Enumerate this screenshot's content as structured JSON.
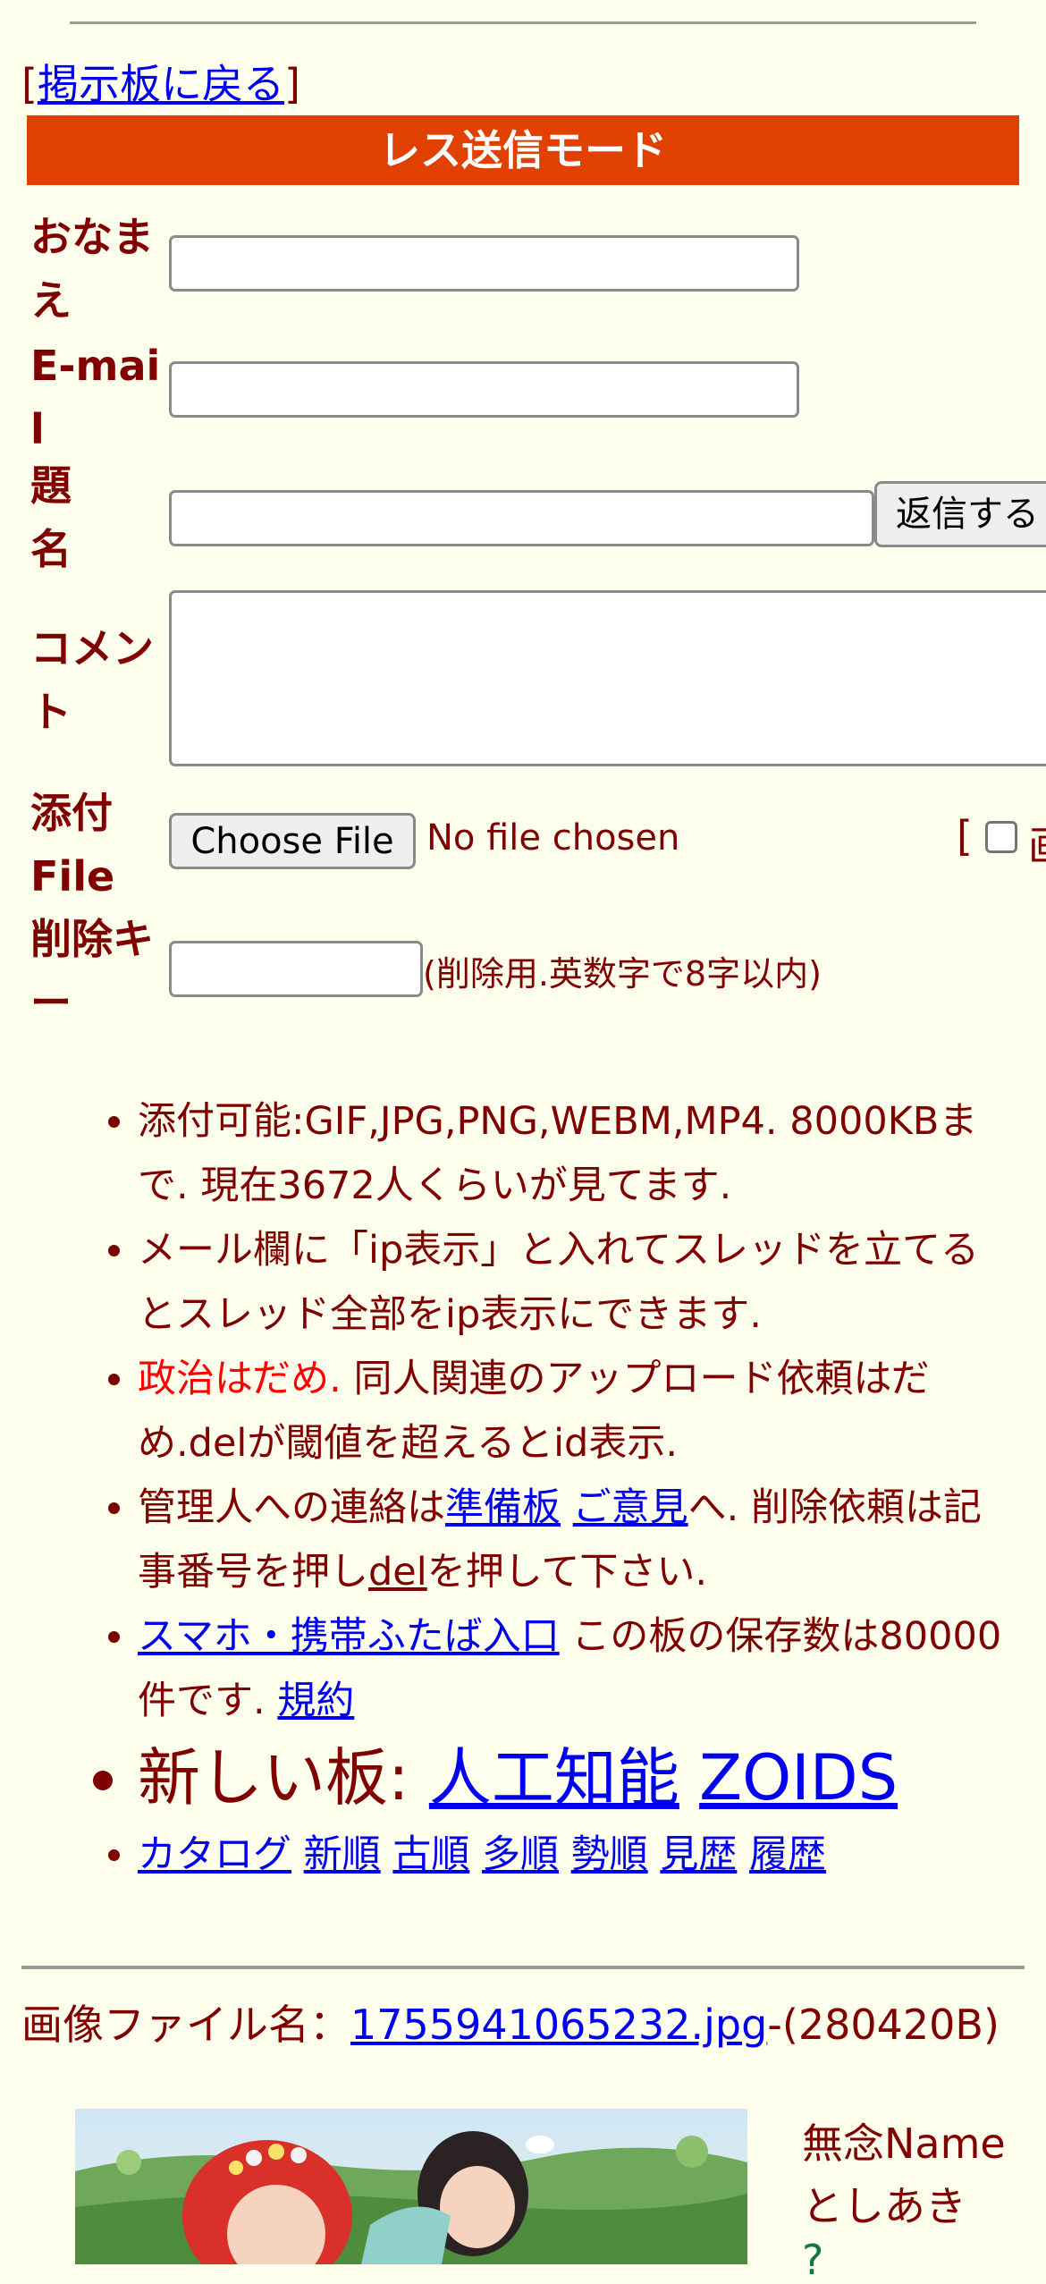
{
  "back_link": {
    "prefix": "[",
    "label": "掲示板に戻る",
    "suffix": "]"
  },
  "mode_banner": "レス送信モード",
  "form": {
    "name_label": "おなまえ",
    "email_label": "E-mail",
    "subject_label": "題名",
    "submit_label": "返信する",
    "comment_label": "コメント",
    "attach_label": "添付File",
    "choose_file_label": "Choose File",
    "no_file_text": "No file chosen",
    "image_option_prefix": "[",
    "image_option_label": "画",
    "delete_key_label": "削除キー",
    "delete_key_hint": "(削除用.英数字で8字以内)"
  },
  "info": {
    "attach": "添付可能:GIF,JPG,PNG,WEBM,MP4. 8000KBまで. 現在3672人くらいが見てます.",
    "ip": "メール欄に「ip表示」と入れてスレッドを立てるとスレッド全部をip表示にできます.",
    "politics_red": "政治はだめ.",
    "politics_rest": " 同人関連のアップロード依頼はだめ.delが閾値を超えるとid表示.",
    "contact_prefix": "管理人への連絡は",
    "contact_link1": "準備板",
    "contact_link2": "ご意見",
    "contact_mid": "へ. 削除依頼は記事番号を押し",
    "contact_del": "del",
    "contact_suffix": "を押して下さい.",
    "mobile_link": "スマホ・携帯ふたば入口",
    "mobile_rest": " この板の保存数は80000件です. ",
    "rules_link": "規約",
    "new_boards_label": "新しい板: ",
    "new_board1": "人工知能",
    "new_board2": "ZOIDS",
    "nav": [
      "カタログ",
      "新順",
      "古順",
      "多順",
      "勢順",
      "見歴",
      "履歴"
    ]
  },
  "post": {
    "file_prefix": "画像ファイル名：",
    "file_name": "1755941065232.jpg",
    "file_size": "-(280420B)",
    "name_line1": "無念Name",
    "name_line2": "としあき",
    "reply_partial": "?"
  },
  "colors": {
    "banner": "#e04000",
    "text": "#800000",
    "link": "#0000ee",
    "background": "#ffffee",
    "warning": "#ff0000"
  }
}
